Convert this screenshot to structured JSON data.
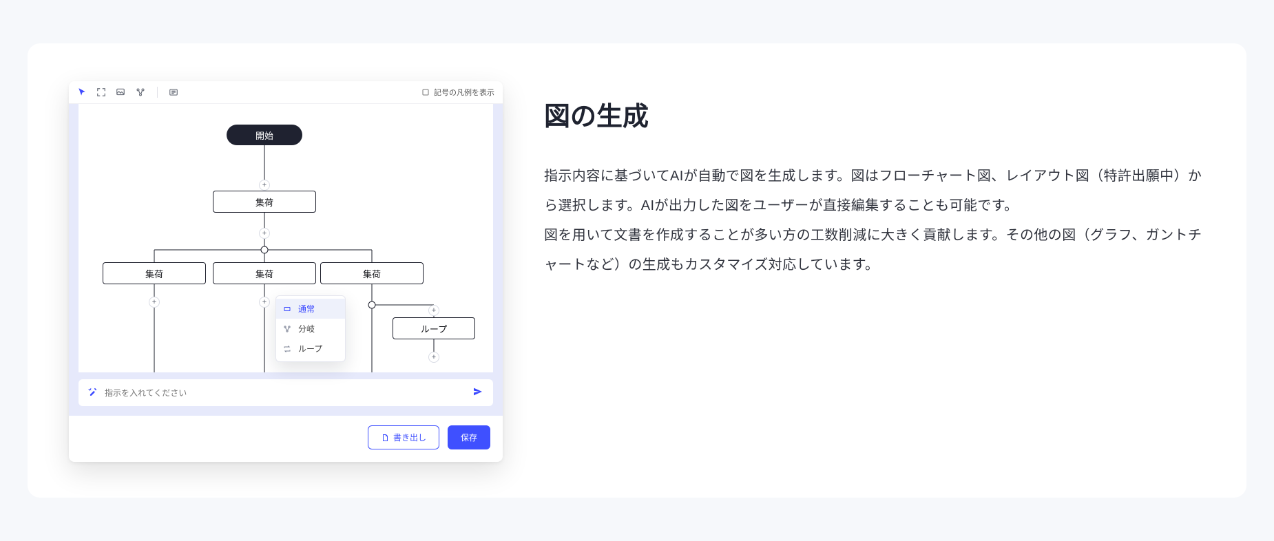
{
  "toolbar": {
    "legend_label": "記号の凡例を表示"
  },
  "flow": {
    "start": "開始",
    "step_collect": "集荷",
    "branch1": "集荷",
    "branch2": "集荷",
    "branch3": "集荷",
    "loop": "ループ"
  },
  "context_menu": {
    "normal": "通常",
    "branch": "分岐",
    "loop": "ループ"
  },
  "prompt": {
    "placeholder": "指示を入れてください"
  },
  "actions": {
    "export": "書き出し",
    "save": "保存"
  },
  "article": {
    "title": "図の生成",
    "p1": "指示内容に基づいてAIが自動で図を生成します。図はフローチャート図、レイアウト図（特許出願中）から選択します。AIが出力した図をユーザーが直接編集することも可能です。",
    "p2": "図を用いて文書を作成することが多い方の工数削減に大きく貢献します。その他の図（グラフ、ガントチャートなど）の生成もカスタマイズ対応しています。"
  }
}
